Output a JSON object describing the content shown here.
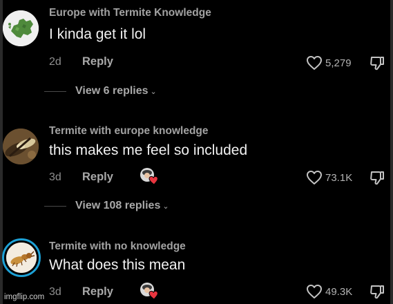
{
  "comments": [
    {
      "username": "Europe with Termite Knowledge",
      "text": "I kinda get it lol",
      "time": "2d",
      "reply_label": "Reply",
      "likes": "5,279",
      "view_replies": "View 6 replies",
      "avatar_icon": "europe-map-icon",
      "creator_liked": false
    },
    {
      "username": "Termite with europe knowledge",
      "text": "this makes me feel so included",
      "time": "3d",
      "reply_label": "Reply",
      "likes": "73.1K",
      "view_replies": "View 108 replies",
      "avatar_icon": "termite-photo-icon",
      "creator_liked": true
    },
    {
      "username": "Termite with no knowledge",
      "text": "What does this mean",
      "time": "3d",
      "reply_label": "Reply",
      "likes": "49.3K",
      "avatar_icon": "termite-drawing-icon",
      "creator_liked": true
    }
  ],
  "watermark": "imgflip.com",
  "colors": {
    "background": "#000000",
    "story_ring": "#1da1d6",
    "creator_heart": "#e8353f"
  }
}
